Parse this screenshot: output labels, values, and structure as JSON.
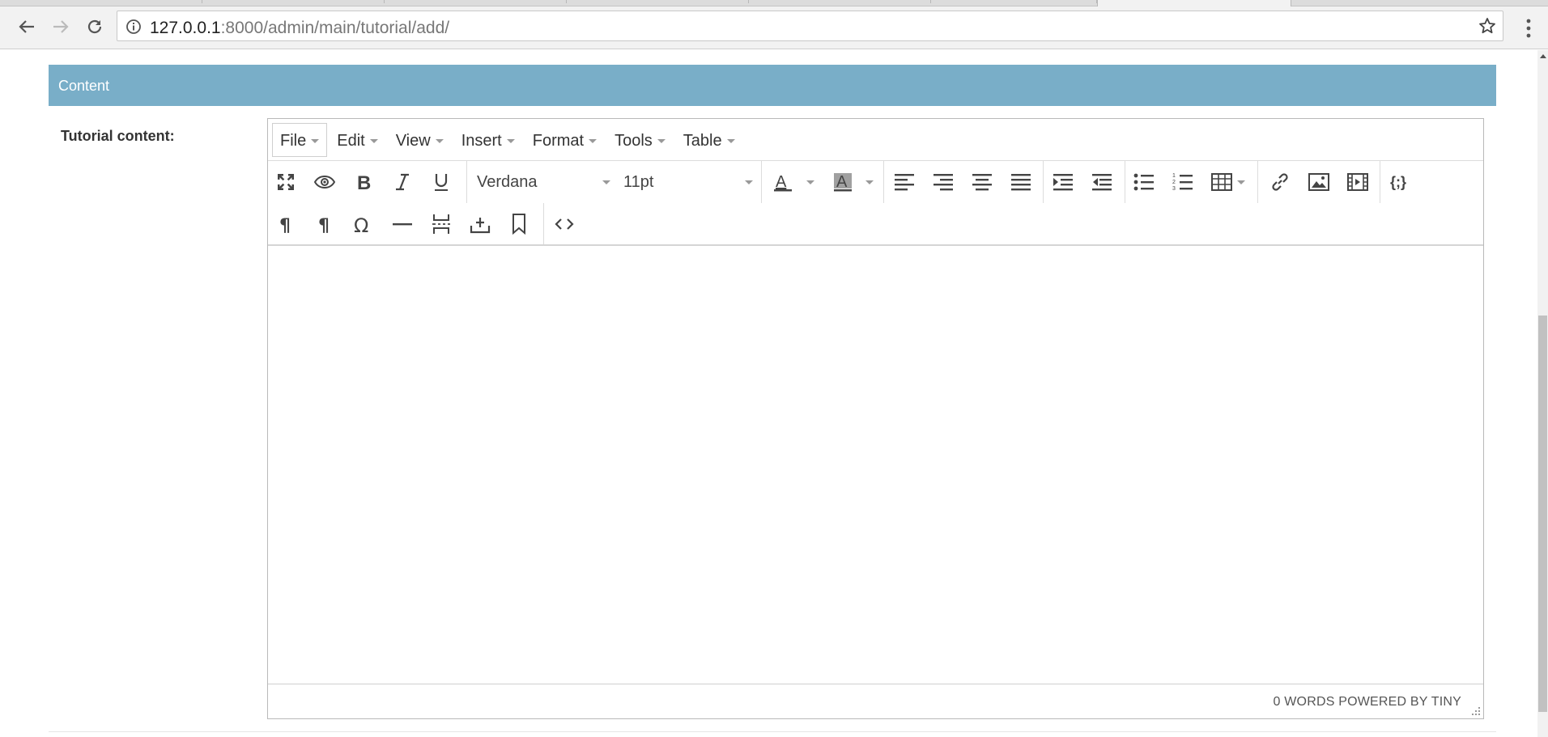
{
  "browser": {
    "address_host": "127.0.0.1",
    "address_rest": ":8000/admin/main/tutorial/add/"
  },
  "page": {
    "fieldset_title": "Content",
    "field_label": "Tutorial content:"
  },
  "editor": {
    "menubar": [
      "File",
      "Edit",
      "View",
      "Insert",
      "Format",
      "Tools",
      "Table"
    ],
    "font_family": "Verdana",
    "font_size": "11pt",
    "status_text": "0 WORDS POWERED BY TINY"
  },
  "icons": {
    "toolbar_row1": [
      "fullscreen-icon",
      "preview-icon",
      "bold-icon",
      "italic-icon",
      "underline-icon",
      "text-color-icon",
      "background-color-icon",
      "align-left-icon",
      "align-right-icon",
      "align-center-icon",
      "align-justify-icon",
      "indent-icon",
      "outdent-icon",
      "bullet-list-icon",
      "numbered-list-icon",
      "table-icon",
      "link-icon",
      "image-icon",
      "media-icon",
      "code-sample-icon"
    ],
    "toolbar_row2": [
      "ltr-icon",
      "rtl-icon",
      "special-char-icon",
      "horizontal-rule-icon",
      "page-break-icon",
      "insert-icon",
      "bookmark-icon",
      "source-code-icon"
    ]
  },
  "colors": {
    "fieldset_header": "#79aec8",
    "toolbar_icon": "#444444"
  }
}
